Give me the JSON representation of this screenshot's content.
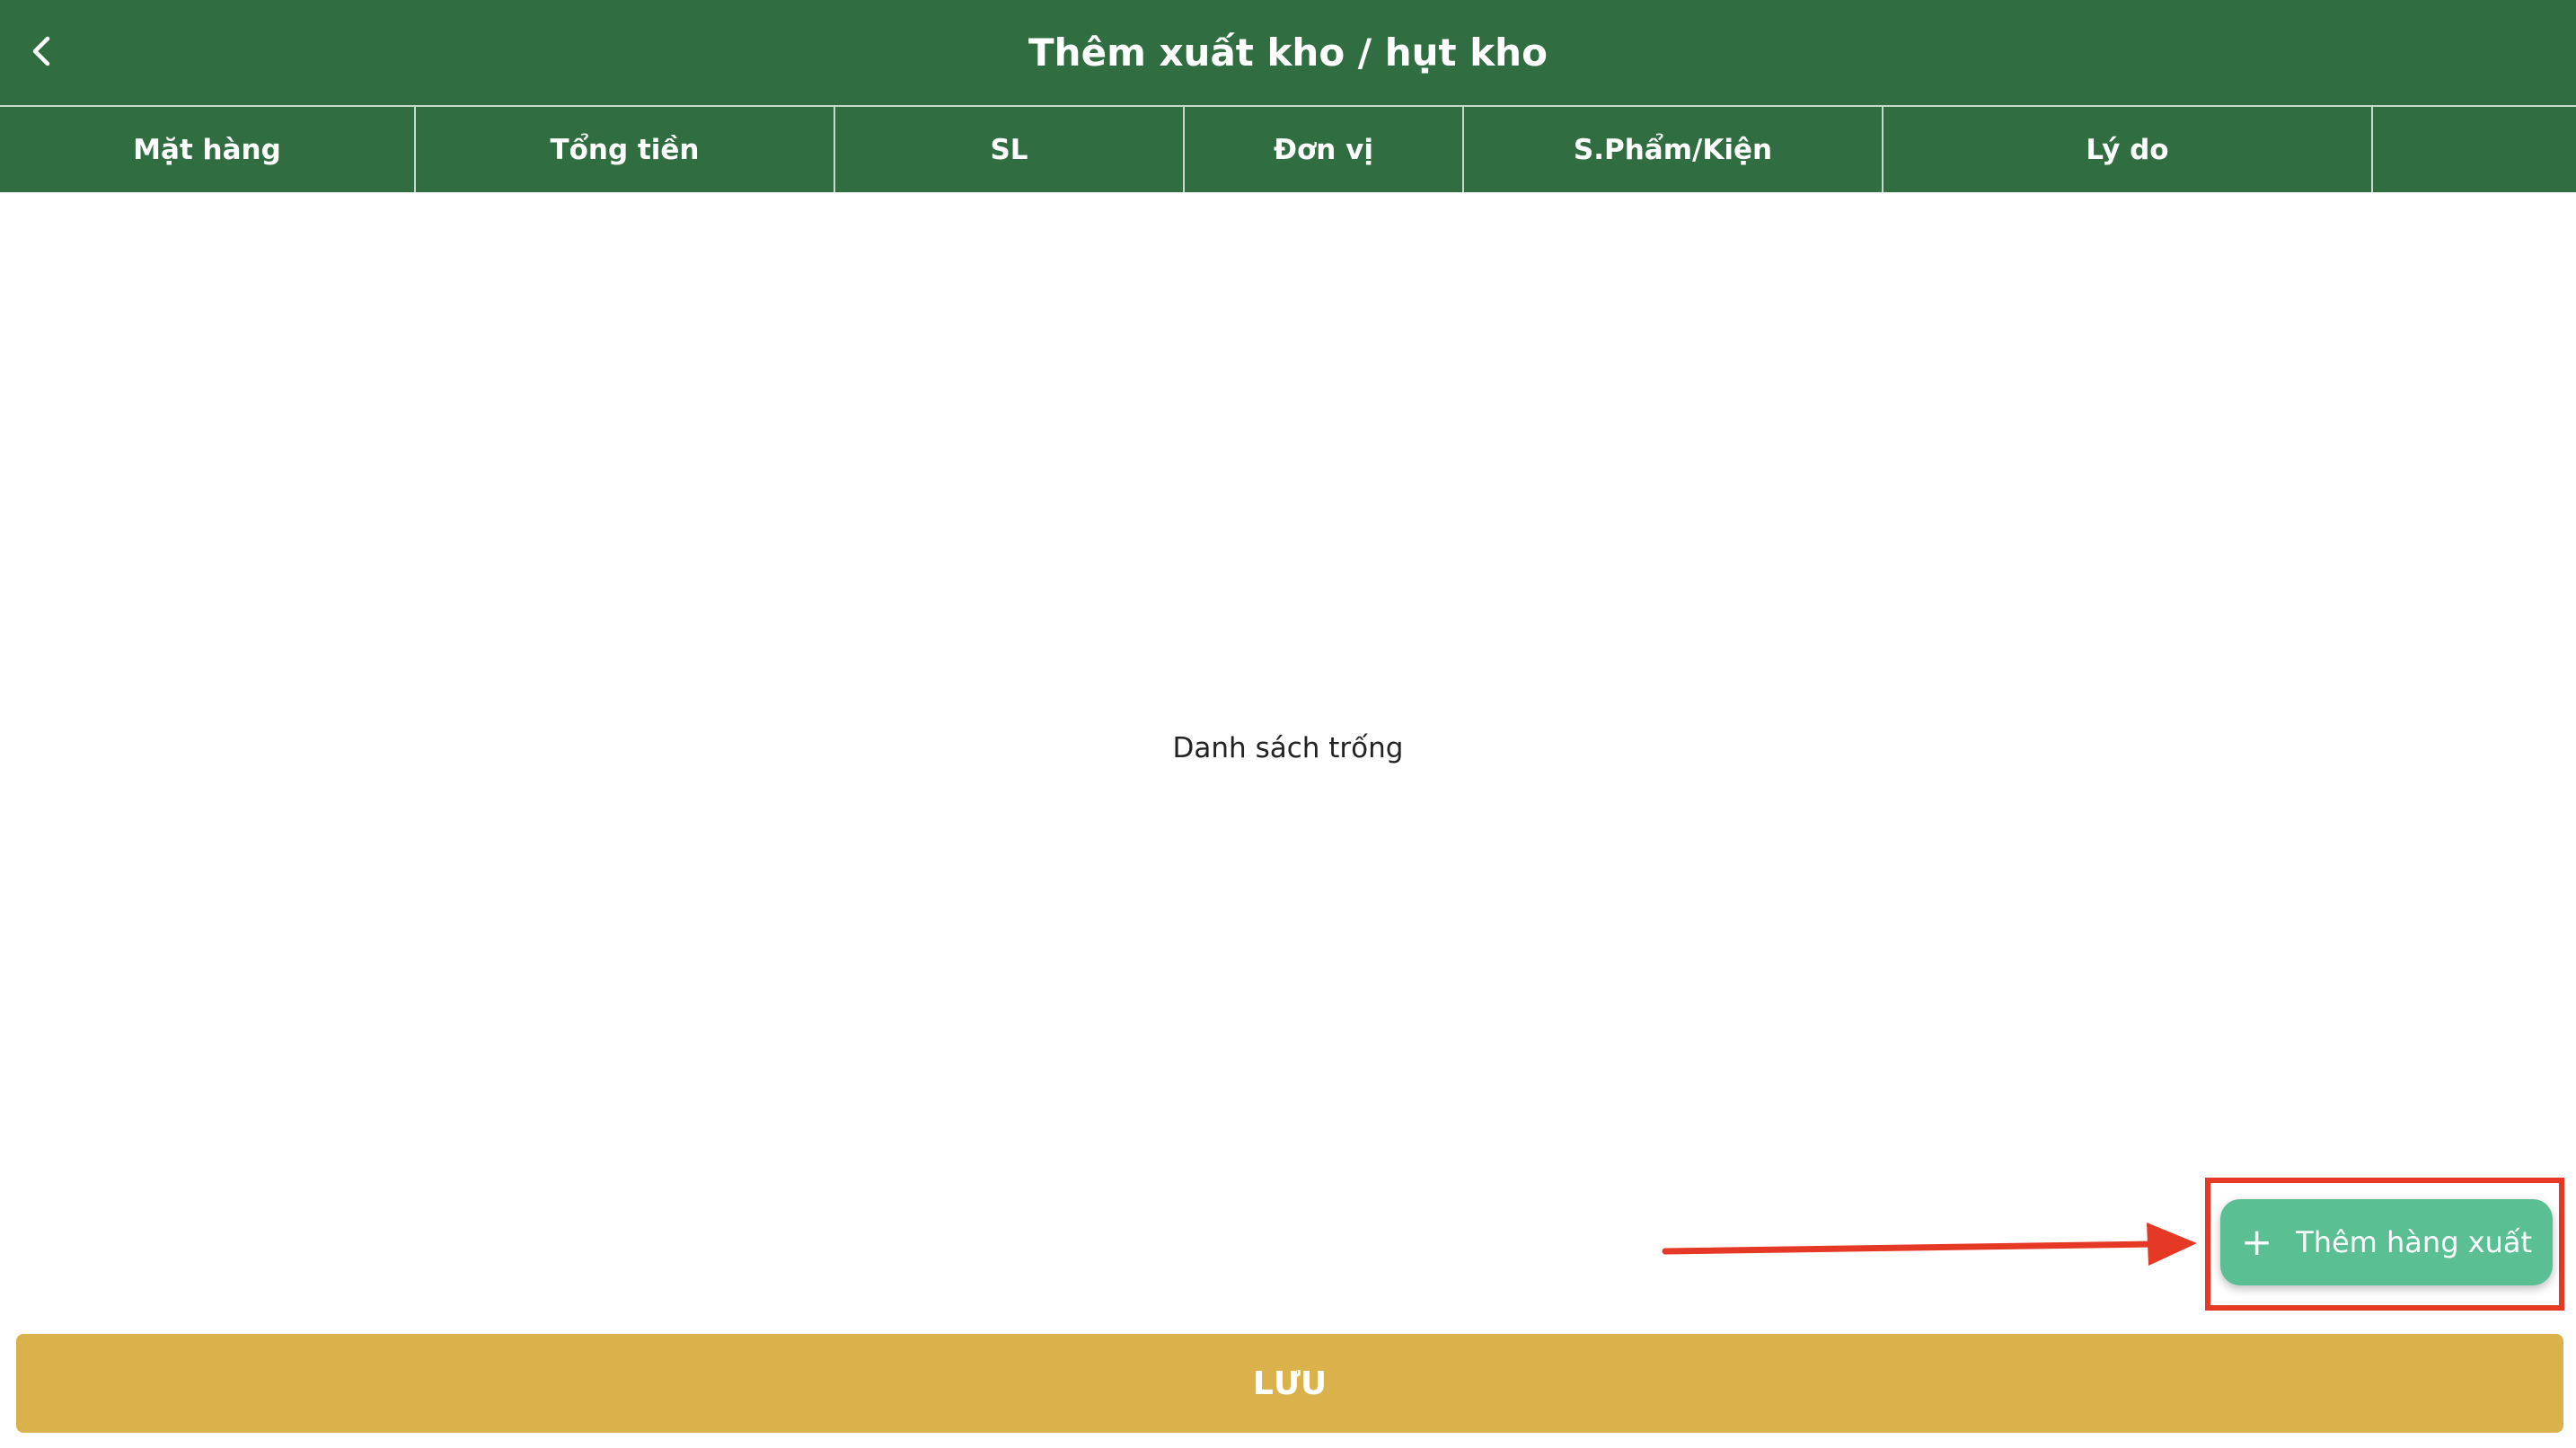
{
  "header": {
    "title": "Thêm xuất kho / hụt kho",
    "back_icon": "chevron-left-icon"
  },
  "table": {
    "columns": [
      {
        "label": "Mặt hàng"
      },
      {
        "label": "Tổng tiền"
      },
      {
        "label": "SL"
      },
      {
        "label": "Đơn vị"
      },
      {
        "label": "S.Phẩm/Kiện"
      },
      {
        "label": "Lý do"
      },
      {
        "label": ""
      }
    ],
    "empty_message": "Danh sách trống"
  },
  "add_button": {
    "label": "Thêm hàng xuất",
    "icon": "plus-icon"
  },
  "save_button": {
    "label": "LƯU"
  },
  "colors": {
    "header_bg": "#306d40",
    "add_button_bg": "#5bbf94",
    "save_button_bg": "#dbb14b",
    "annotation": "#e53825"
  }
}
